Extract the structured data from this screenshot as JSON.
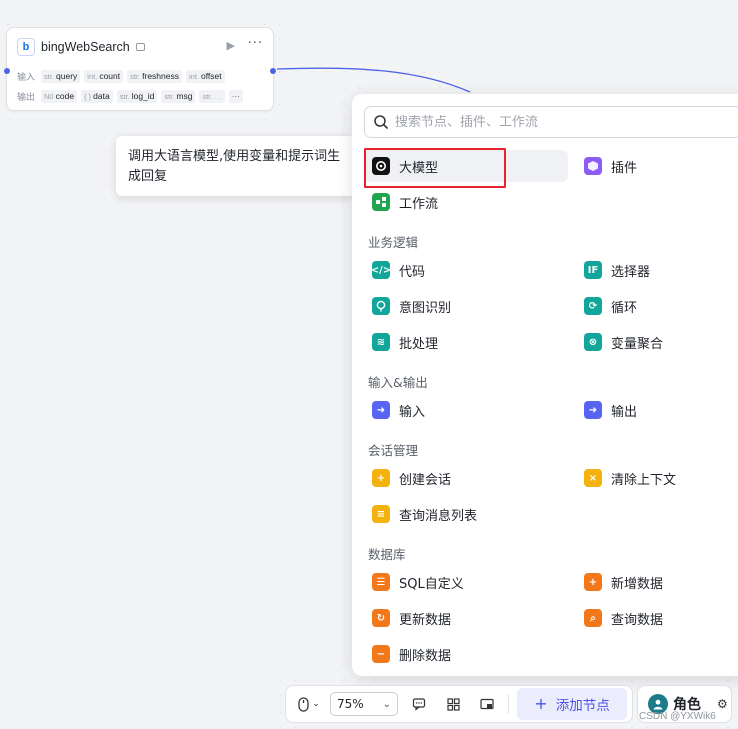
{
  "node": {
    "title": "bingWebSearch",
    "input_label": "输入",
    "output_label": "输出",
    "inputs": [
      {
        "type": "str.",
        "name": "query"
      },
      {
        "type": "int.",
        "name": "count"
      },
      {
        "type": "str.",
        "name": "freshness"
      },
      {
        "type": "int.",
        "name": "offset"
      }
    ],
    "outputs": [
      {
        "type": "N0",
        "name": "code"
      },
      {
        "type": "{ }",
        "name": "data"
      },
      {
        "type": "str.",
        "name": "log_id"
      },
      {
        "type": "str.",
        "name": "msg"
      },
      {
        "type": "str.",
        "name": "..."
      }
    ],
    "more_tag": "···"
  },
  "tooltip": {
    "text": "调用大语言模型,使用变量和提示词生成回复"
  },
  "panel": {
    "search_placeholder": "搜索节点、插件、工作流",
    "top_items": [
      {
        "label": "大模型",
        "icon": "llm-icon",
        "color": "#111111"
      },
      {
        "label": "插件",
        "icon": "plugin-icon",
        "color": "#8b5cf6"
      },
      {
        "label": "工作流",
        "icon": "workflow-icon",
        "color": "#22a550"
      }
    ],
    "sections": [
      {
        "title": "业务逻辑",
        "items": [
          {
            "label": "代码",
            "icon": "code-icon",
            "color": "#12a69a"
          },
          {
            "label": "选择器",
            "icon": "if-icon",
            "color": "#12a69a"
          },
          {
            "label": "意图识别",
            "icon": "intent-icon",
            "color": "#12a69a"
          },
          {
            "label": "循环",
            "icon": "loop-icon",
            "color": "#12a69a"
          },
          {
            "label": "批处理",
            "icon": "batch-icon",
            "color": "#12a69a"
          },
          {
            "label": "变量聚合",
            "icon": "aggregate-icon",
            "color": "#12a69a"
          }
        ]
      },
      {
        "title": "输入&输出",
        "items": [
          {
            "label": "输入",
            "icon": "input-icon",
            "color": "#5865f2"
          },
          {
            "label": "输出",
            "icon": "output-icon",
            "color": "#5865f2"
          }
        ]
      },
      {
        "title": "会话管理",
        "items": [
          {
            "label": "创建会话",
            "icon": "create-session-icon",
            "color": "#f5b10d"
          },
          {
            "label": "清除上下文",
            "icon": "clear-context-icon",
            "color": "#f5b10d"
          },
          {
            "label": "查询消息列表",
            "icon": "message-list-icon",
            "color": "#f5b10d"
          }
        ]
      },
      {
        "title": "数据库",
        "items": [
          {
            "label": "SQL自定义",
            "icon": "sql-icon",
            "color": "#f3781a"
          },
          {
            "label": "新增数据",
            "icon": "add-data-icon",
            "color": "#f3781a"
          },
          {
            "label": "更新数据",
            "icon": "update-data-icon",
            "color": "#f3781a"
          },
          {
            "label": "查询数据",
            "icon": "query-data-icon",
            "color": "#f3781a"
          },
          {
            "label": "删除数据",
            "icon": "delete-data-icon",
            "color": "#f3781a"
          }
        ]
      }
    ]
  },
  "toolbar": {
    "zoom": "75%",
    "add_node_label": "添加节点",
    "role_label": "角色"
  },
  "watermark": "CSDN @YXWik6",
  "colors": {
    "accent": "#4d53e8",
    "edge": "#4e62e6",
    "highlight_box": "#e8232f"
  }
}
